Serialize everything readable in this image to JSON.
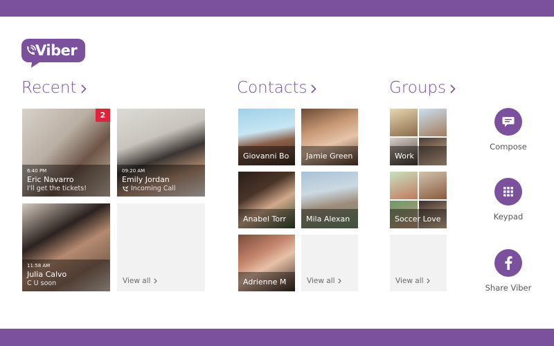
{
  "app": {
    "logo_text": "Viber"
  },
  "colors": {
    "brand": "#7b519d",
    "badge": "#e2213b",
    "empty_tile": "#f2f2f2"
  },
  "recent": {
    "heading": "Recent",
    "items": [
      {
        "time": "6:40 PM",
        "name": "Eric Navarro",
        "message": "I'll get the tickets!",
        "unread": "2"
      },
      {
        "time": "09:20 AM",
        "name": "Emily Jordan",
        "message": "Incoming Call",
        "icon": "phone-incoming-icon"
      },
      {
        "time": "11:58 AM",
        "name": "Julia Calvo",
        "message": "C U soon"
      }
    ],
    "view_all": "View all"
  },
  "contacts": {
    "heading": "Contacts",
    "items": [
      {
        "name": "Giovanni Bo"
      },
      {
        "name": "Jamie Green"
      },
      {
        "name": "Anabel Torr"
      },
      {
        "name": "Mila Alexan"
      },
      {
        "name": "Adrienne M"
      }
    ],
    "view_all": "View all"
  },
  "groups": {
    "heading": "Groups",
    "items": [
      {
        "name": "Work"
      },
      {
        "name": "Soccer Love"
      }
    ],
    "view_all": "View all"
  },
  "actions": [
    {
      "label": "Compose",
      "icon": "compose-icon"
    },
    {
      "label": "Keypad",
      "icon": "keypad-icon"
    },
    {
      "label": "Share Viber",
      "icon": "facebook-icon"
    }
  ]
}
